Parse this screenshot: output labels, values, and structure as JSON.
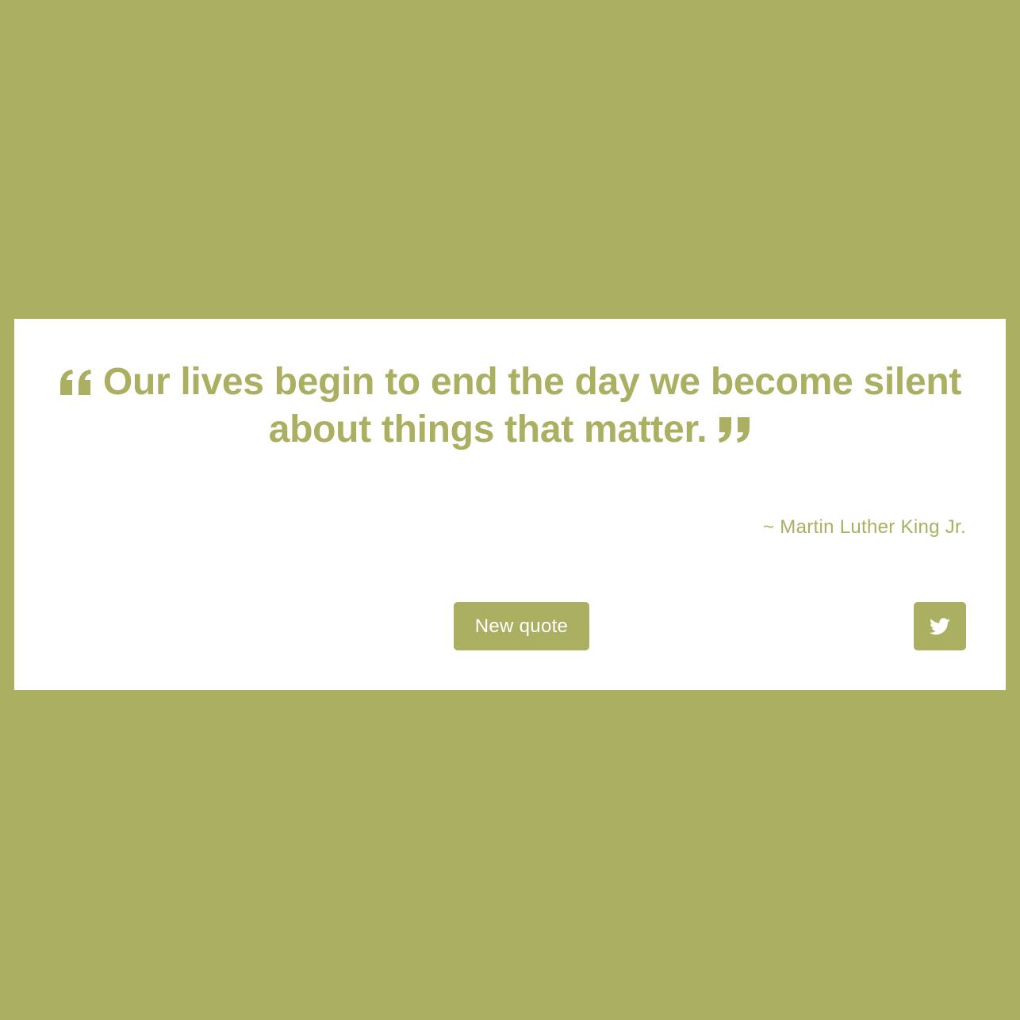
{
  "quote": {
    "text": "Our lives begin to end the day we become silent about things that matter.",
    "author": "~ Martin Luther King Jr."
  },
  "buttons": {
    "new_quote_label": "New quote",
    "tweet_icon": "twitter-icon"
  },
  "colors": {
    "accent": "#abaf61",
    "card": "#ffffff"
  }
}
